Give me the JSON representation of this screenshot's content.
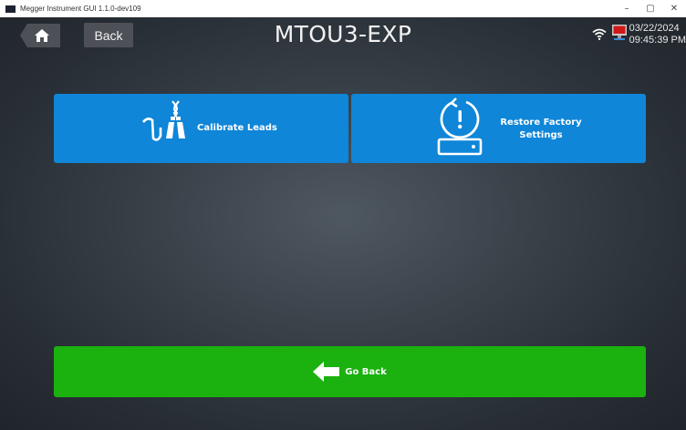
{
  "window": {
    "title": "Megger Instrument GUI 1.1.0-dev109",
    "controls": {
      "minimize": "–",
      "maximize": "▢",
      "close": "✕"
    }
  },
  "header": {
    "back_label": "Back",
    "title": "MTOU3-EXP",
    "date": "03/22/2024",
    "time": "09:45:39 PM"
  },
  "tiles": {
    "calibrate_label": "Calibrate Leads",
    "restore_line1": "Restore Factory",
    "restore_line2": "Settings"
  },
  "footer": {
    "go_back_label": "Go Back"
  },
  "colors": {
    "tile_blue": "#0f86d8",
    "go_back_green": "#1bb10f",
    "header_button": "#4d5157"
  },
  "icons": [
    "home-icon",
    "wifi-icon",
    "monitor-icon",
    "lead-clip-icon",
    "restore-icon",
    "arrow-left-icon"
  ]
}
